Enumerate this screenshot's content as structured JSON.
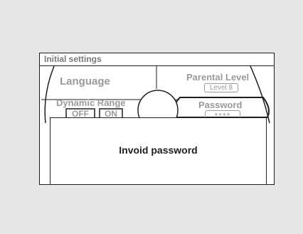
{
  "screen": {
    "title": "Initial settings"
  },
  "menu": {
    "language": {
      "label": "Language"
    },
    "dynamic_range": {
      "label": "Dynamic Range",
      "off_label": "OFF",
      "on_label": "ON"
    },
    "parental_level": {
      "label": "Parental Level",
      "value": "Level 8"
    },
    "password": {
      "label": "Password",
      "value": "****"
    }
  },
  "dialog": {
    "message": "Invoid password"
  }
}
